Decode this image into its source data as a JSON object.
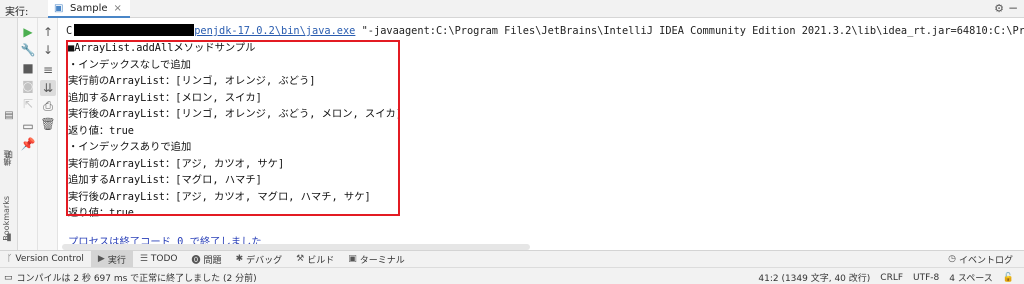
{
  "run_header": {
    "title": "実行:",
    "tab_label": "Sample"
  },
  "console": {
    "cmd_prefix": "C",
    "java_path": "penjdk-17.0.2\\bin\\java.exe",
    "cmd_rest": " \"-javaagent:C:\\Program Files\\JetBrains\\IntelliJ IDEA Community Edition 2021.3.2\\lib\\idea_rt.jar=64810:C:\\Program",
    "lines": [
      "■ArrayList.addAllメソッドサンプル",
      "・インデックスなしで追加",
      "実行前のArrayList：[リンゴ, オレンジ, ぶどう]",
      "追加するArrayList：[メロン, スイカ]",
      "実行後のArrayList：[リンゴ, オレンジ, ぶどう, メロン, スイカ]",
      "返り値：true",
      "・インデックスありで追加",
      "実行前のArrayList：[アジ, カツオ, サケ]",
      "追加するArrayList：[マグロ, ハマチ]",
      "実行後のArrayList：[アジ, カツオ, マグロ, ハマチ, サケ]",
      "返り値：true"
    ],
    "process_exit": "プロセスは終了コード 0 で終了しました"
  },
  "side_labels": {
    "structure": "構造",
    "bookmarks": "Bookmarks"
  },
  "tool_tabs": {
    "version_control": "Version Control",
    "run": "実行",
    "todo": "TODO",
    "problems": "問題",
    "debug": "デバッグ",
    "build": "ビルド",
    "terminal": "ターミナル",
    "event_log": "イベントログ"
  },
  "status_bar": {
    "message": "コンパイルは 2 秒 697 ms で正常に終了しました (2 分前)",
    "position": "41:2 (1349 文字, 40 改行)",
    "line_sep": "CRLF",
    "encoding": "UTF-8",
    "indent": "4 スペース"
  },
  "colors": {
    "highlight_border": "#e31b23",
    "link": "#2a5db0",
    "process_text": "#2a40b8",
    "run_green": "#4caf50"
  }
}
